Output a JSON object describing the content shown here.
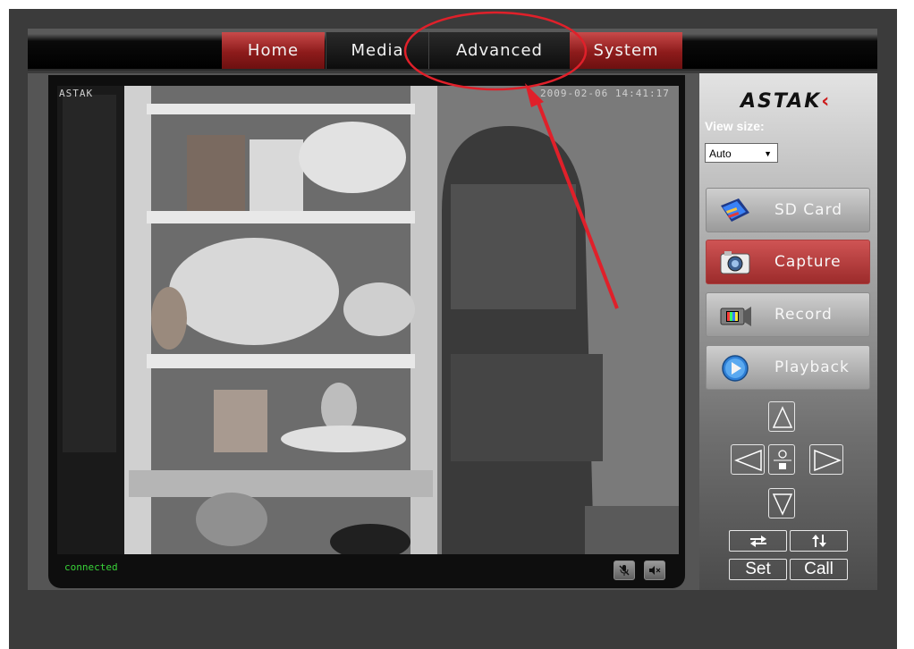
{
  "nav": {
    "tabs": [
      {
        "label": "Home"
      },
      {
        "label": "Media"
      },
      {
        "label": "Advanced"
      },
      {
        "label": "System"
      }
    ]
  },
  "video": {
    "overlay_left": "ASTAK",
    "overlay_right": "2009-02-06 14:41:17",
    "status": "connected",
    "status_color": "#39d439"
  },
  "sidebar": {
    "logo": "ASTAK",
    "view_size_label": "View size:",
    "view_size_value": "Auto",
    "buttons": [
      {
        "label": "SD Card",
        "icon": "sd-card-icon"
      },
      {
        "label": "Capture",
        "icon": "camera-icon"
      },
      {
        "label": "Record",
        "icon": "video-camera-icon"
      },
      {
        "label": "Playback",
        "icon": "play-icon"
      }
    ],
    "set_label": "Set",
    "call_label": "Call"
  },
  "colors": {
    "accent": "#9c2b2b",
    "annotation": "#e0202a"
  }
}
